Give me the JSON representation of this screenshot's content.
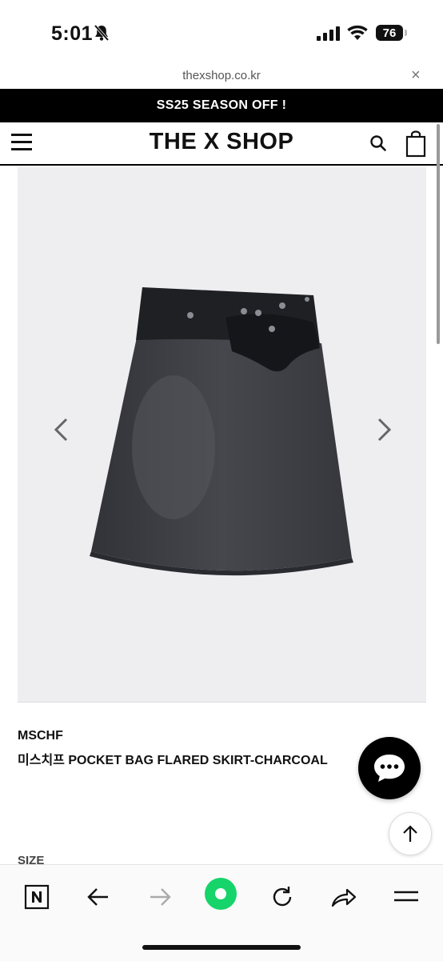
{
  "status_bar": {
    "time": "5:01",
    "battery": "76",
    "icons": [
      "bell-slash-icon",
      "signal-icon",
      "wifi-icon",
      "battery-icon"
    ]
  },
  "url_bar": {
    "url": "thexshop.co.kr",
    "close": "×"
  },
  "promo": {
    "text": "SS25 SEASON OFF !"
  },
  "header": {
    "logo": "THE X SHOP",
    "icons": [
      "menu-icon",
      "search-icon",
      "shopping-bag-icon"
    ]
  },
  "product": {
    "brand": "MSCHF",
    "name": "미스치프 POCKET BAG FLARED SKIRT-CHARCOAL",
    "size_label": "SIZE",
    "image_background": "#eeeef1",
    "skirt_color": "#3c3d42"
  },
  "floating": {
    "chat": "chat-bubble-icon",
    "top": "arrow-up-icon"
  },
  "toolbar": {
    "items": [
      "naver-n-icon",
      "back-arrow-icon",
      "forward-arrow-icon",
      "naver-green-dot-icon",
      "reload-icon",
      "share-icon",
      "menu-icon"
    ],
    "accent": "#15d46a"
  }
}
